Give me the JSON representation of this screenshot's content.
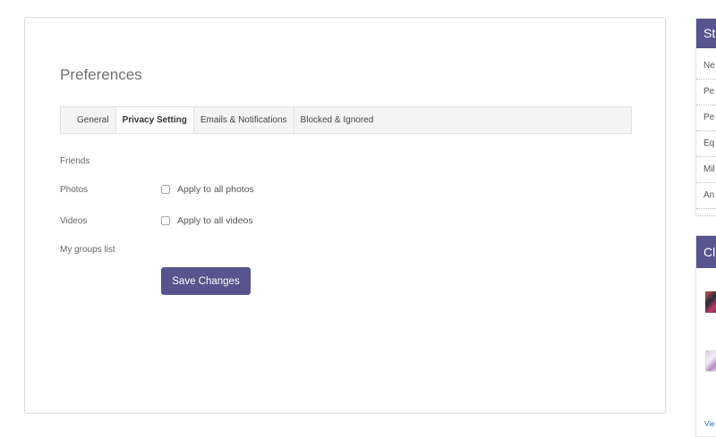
{
  "preferences": {
    "title": "Preferences",
    "tabs": [
      {
        "label": "General"
      },
      {
        "label": "Privacy Setting"
      },
      {
        "label": "Emails & Notifications"
      },
      {
        "label": "Blocked & Ignored"
      }
    ],
    "active_tab": "Privacy Setting",
    "rows": {
      "friends_label": "Friends",
      "photos_label": "Photos",
      "photos_checkbox": "Apply to all photos",
      "videos_label": "Videos",
      "videos_checkbox": "Apply to all videos",
      "groups_label": "My groups list"
    },
    "save_label": "Save Changes"
  },
  "right_column": {
    "widget1": {
      "title": "St",
      "items": [
        "Ne",
        "Pe",
        "Pe",
        "Eq",
        "Mil",
        "An"
      ]
    },
    "widget2": {
      "title": "Cl",
      "link": "Vie"
    }
  },
  "colors": {
    "accent": "#58548e",
    "border": "#dddddd",
    "tab_bar": "#f4f4f4"
  }
}
